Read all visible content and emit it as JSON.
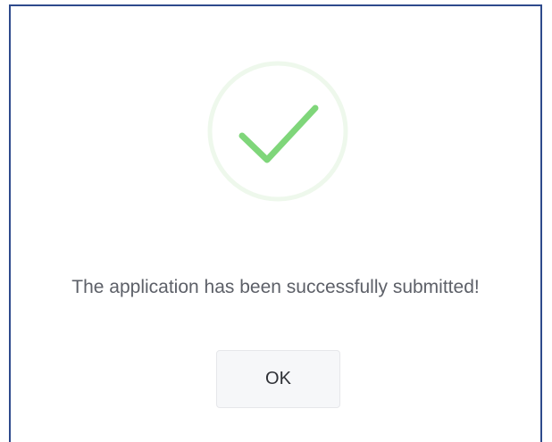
{
  "dialog": {
    "icon": "success-check-icon",
    "message": "The application has been successfully submitted!",
    "ok_label": "OK"
  },
  "colors": {
    "frame_border": "#2e4a8c",
    "check_stroke": "#7fd67a",
    "check_ring": "#eef8ec",
    "message_text": "#5d6068",
    "button_bg": "#f6f7f9",
    "button_border": "#e6e7ea"
  }
}
